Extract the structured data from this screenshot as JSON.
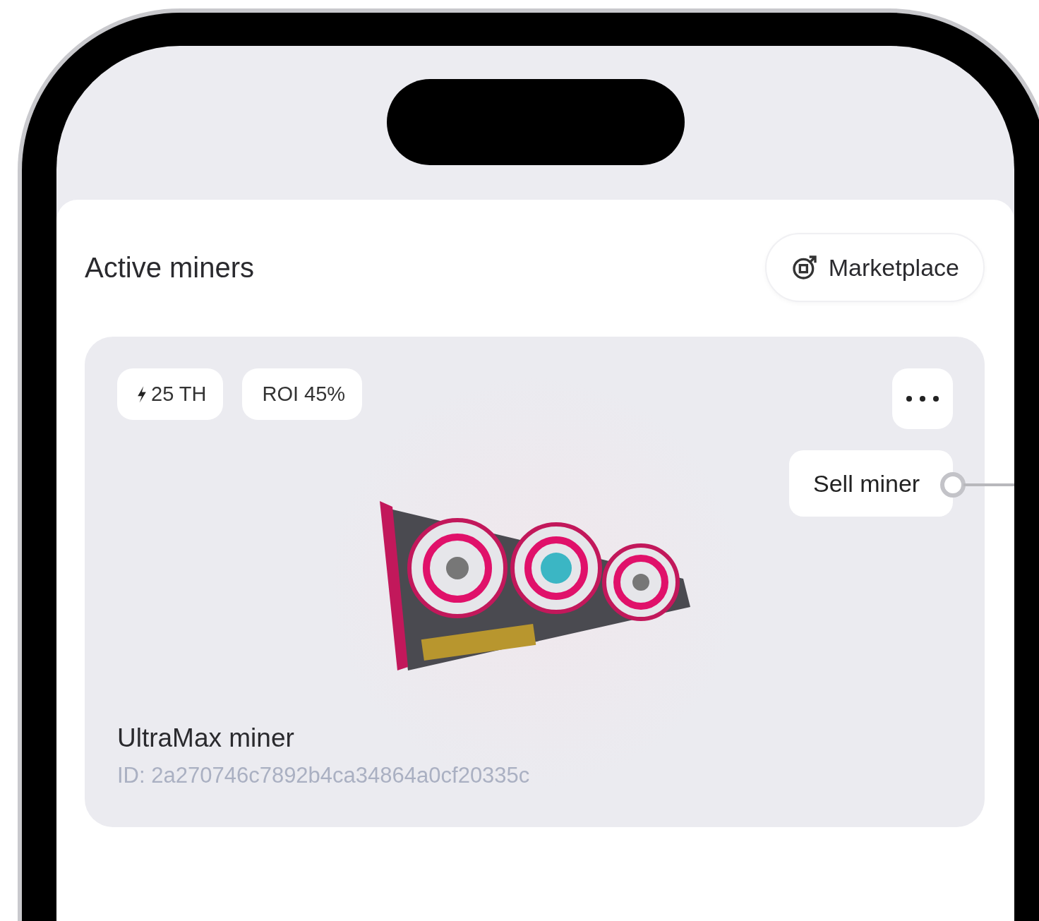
{
  "section": {
    "title": "Active miners",
    "action_button": "Marketplace"
  },
  "miner_card": {
    "badges": [
      {
        "kind": "hashrate",
        "text": "25 TH"
      },
      {
        "kind": "plain",
        "text": "ROI 45%"
      }
    ],
    "tooltip": "Sell miner",
    "name": "UltraMax miner",
    "id": "ID: 2a270746c7892b4ca34864a0cf20335c"
  }
}
